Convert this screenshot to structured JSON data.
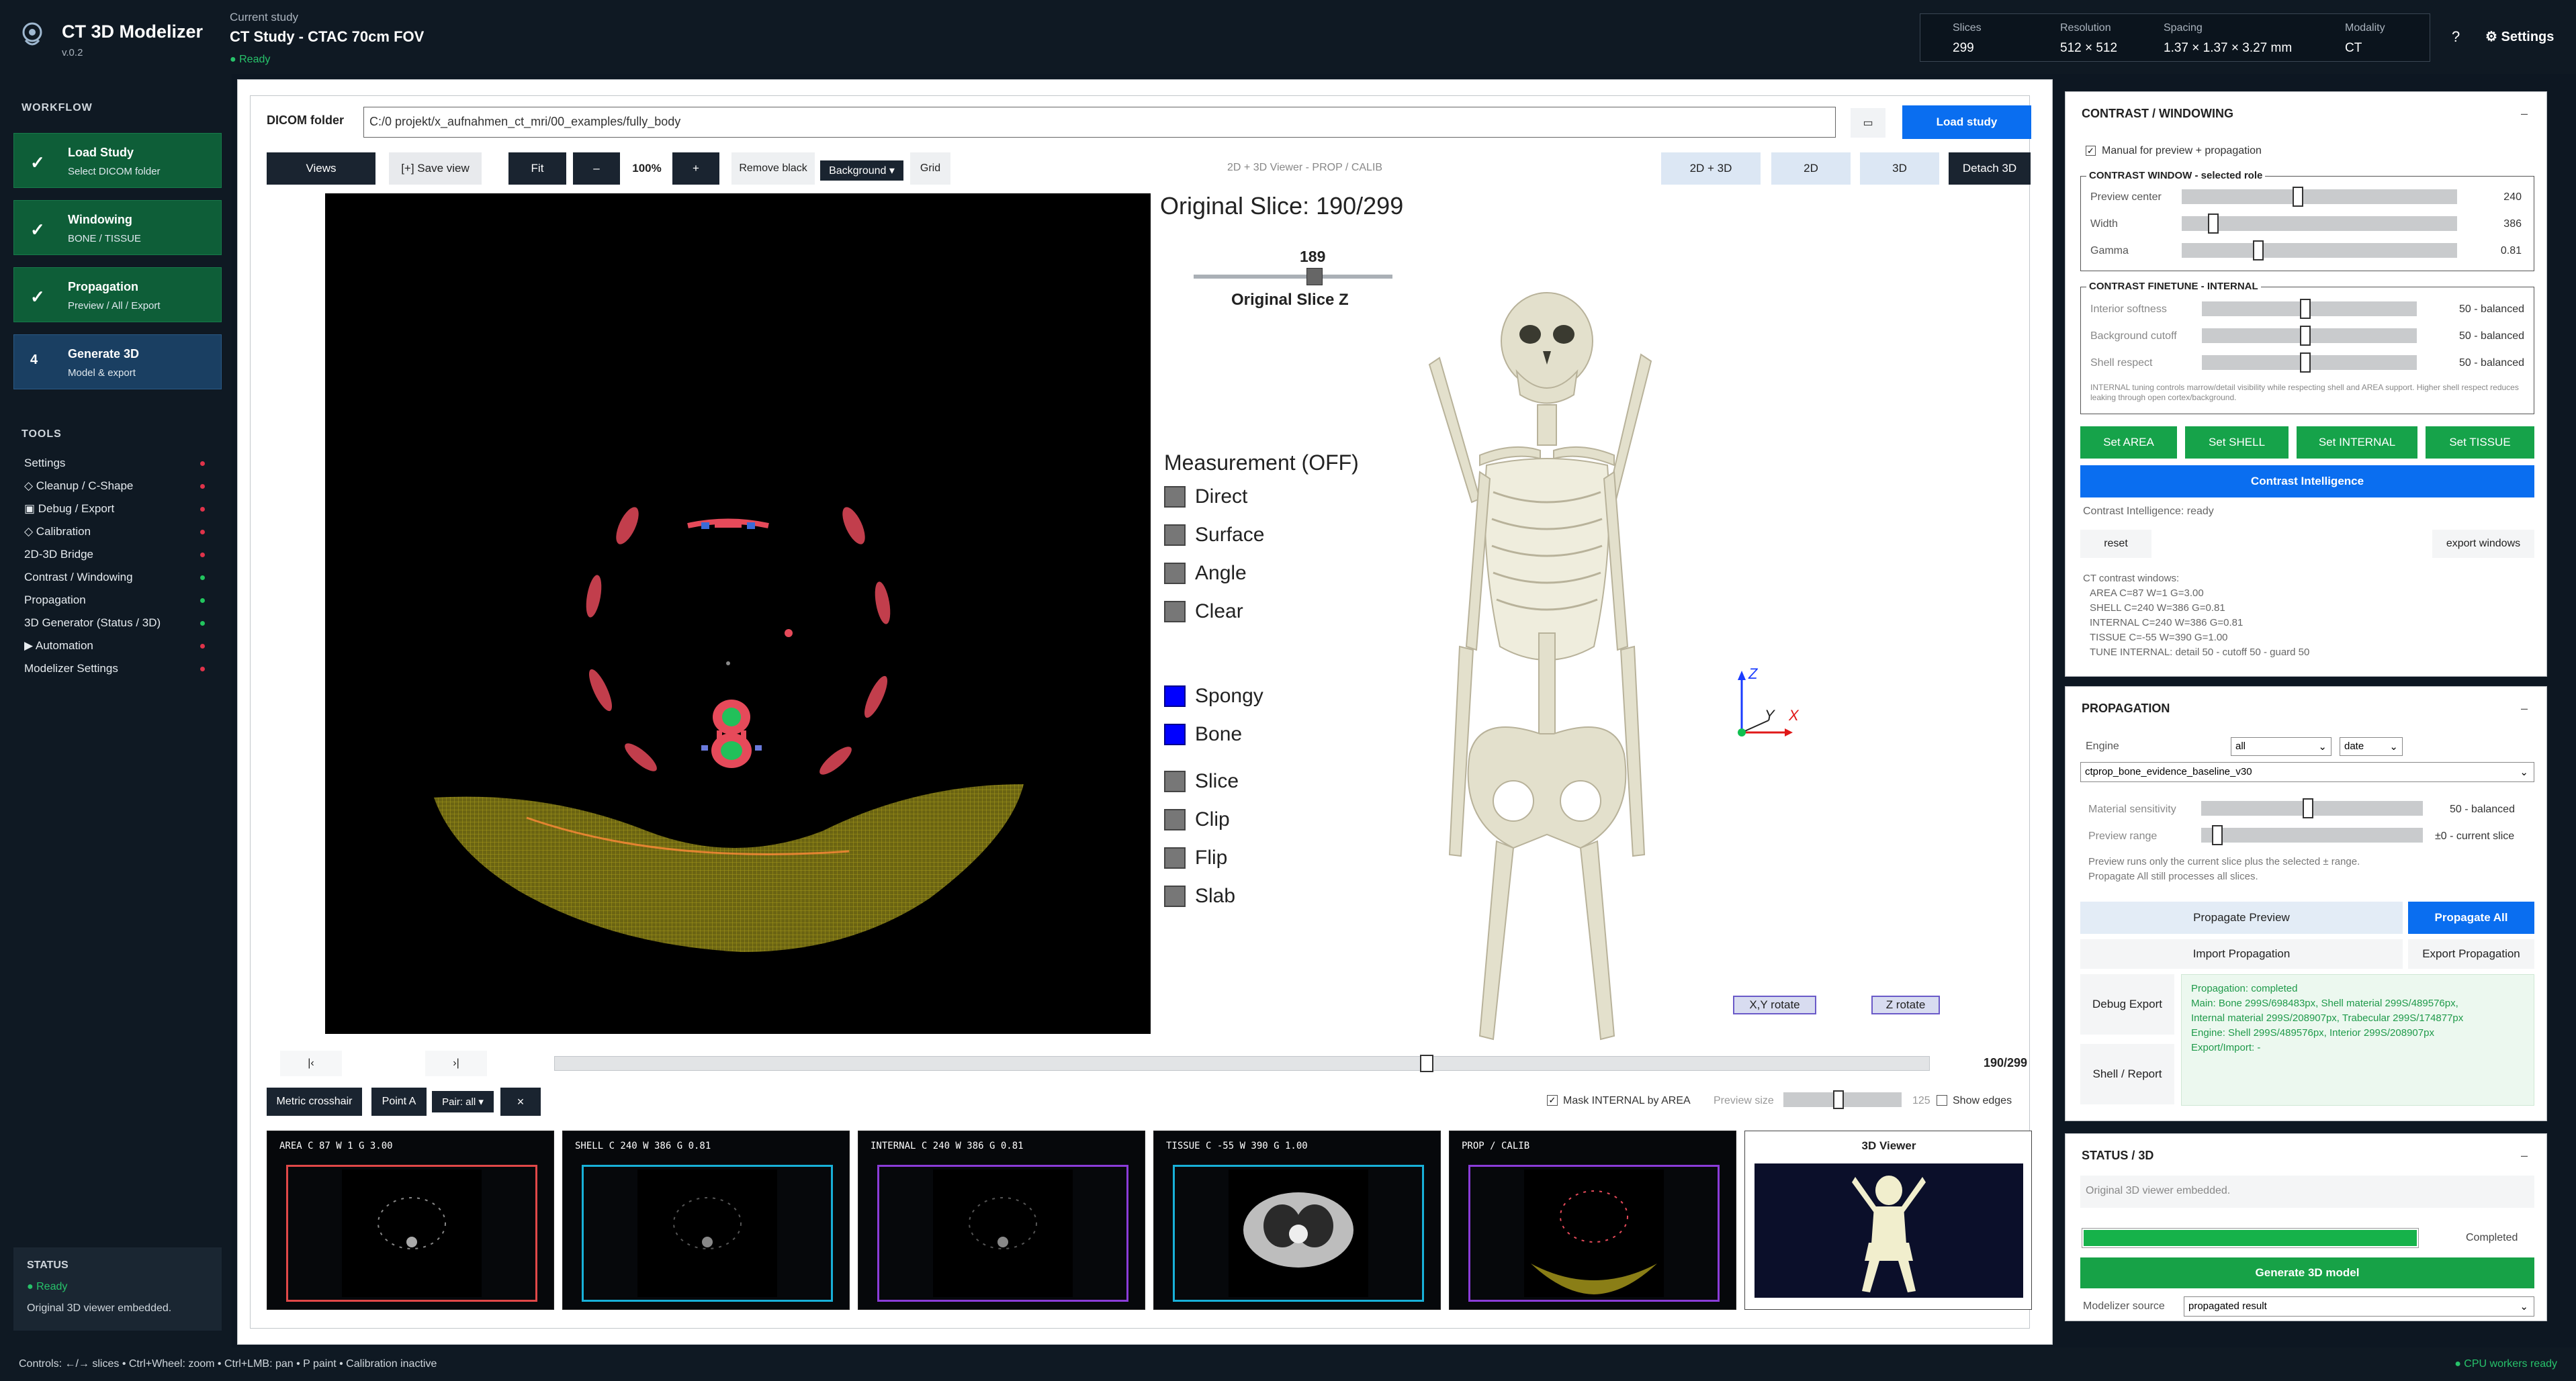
{
  "header": {
    "app_title": "CT 3D Modelizer",
    "app_version": "v.0.2",
    "current_study_label": "Current study",
    "current_study": "CT Study - CTAC 70cm FOV",
    "status": "● Ready",
    "info": [
      {
        "label": "Slices",
        "value": "299"
      },
      {
        "label": "Resolution",
        "value": "512 × 512"
      },
      {
        "label": "Spacing",
        "value": "1.37 × 1.37 × 3.27 mm"
      },
      {
        "label": "Modality",
        "value": "CT"
      }
    ],
    "help": "?",
    "settings": "⚙ Settings"
  },
  "sidebar": {
    "workflow_title": "WORKFLOW",
    "workflow": [
      {
        "icon": "✓",
        "title": "Load Study",
        "sub": "Select DICOM folder"
      },
      {
        "icon": "✓",
        "title": "Windowing",
        "sub": "BONE / TISSUE"
      },
      {
        "icon": "✓",
        "title": "Propagation",
        "sub": "Preview / All / Export"
      },
      {
        "icon": "4",
        "title": "Generate 3D",
        "sub": "Model & export"
      }
    ],
    "tools_title": "TOOLS",
    "tools": [
      {
        "label": "Settings",
        "color": "#e0334a"
      },
      {
        "label": "◇ Cleanup / C-Shape",
        "color": "#e0334a"
      },
      {
        "label": "▣ Debug / Export",
        "color": "#e0334a"
      },
      {
        "label": "◇ Calibration",
        "color": "#e0334a"
      },
      {
        "label": "2D-3D Bridge",
        "color": "#e0334a"
      },
      {
        "label": "Contrast / Windowing",
        "color": "#22c55e"
      },
      {
        "label": "Propagation",
        "color": "#22c55e"
      },
      {
        "label": "3D Generator (Status / 3D)",
        "color": "#22c55e"
      },
      {
        "label": "▶ Automation",
        "color": "#e0334a"
      },
      {
        "label": "Modelizer Settings",
        "color": "#e0334a"
      }
    ],
    "status_title": "STATUS",
    "status_ready": "● Ready",
    "status_msg": "Original 3D viewer embedded."
  },
  "dicom": {
    "label": "DICOM folder",
    "path": "C:/0 projekt/x_aufnahmen_ct_mri/00_examples/fully_body",
    "folder_icon": "▭",
    "load_label": "Load study"
  },
  "toolbar": {
    "views": "Views",
    "save_view": "[+] Save view",
    "fit": "Fit",
    "minus": "–",
    "zoom": "100%",
    "plus": "+",
    "remove_black": "Remove black",
    "background": "Background ▾",
    "grid": "Grid",
    "viewer_title": "2D + 3D Viewer - PROP / CALIB",
    "view_2d3d": "2D + 3D",
    "view_2d": "2D",
    "view_3d": "3D",
    "detach": "Detach 3D"
  },
  "viewer": {
    "original_slice": "Original Slice: 190/299",
    "slider_value": "189",
    "slider_label": "Original Slice Z",
    "measurement_title": "Measurement (OFF)",
    "measure_items": [
      "Direct",
      "Surface",
      "Angle",
      "Clear"
    ],
    "tissue_items": [
      "Spongy",
      "Bone"
    ],
    "view_items": [
      "Slice",
      "Clip",
      "Flip",
      "Slab"
    ],
    "axis_z": "Z",
    "axis_y": "Y",
    "axis_x": "X",
    "xy_rotate": "X,Y rotate",
    "z_rotate": "Z rotate",
    "slice_count": "190/299",
    "slice_fraction": 0.635,
    "prev": "|‹",
    "next": "›|"
  },
  "bottom_toolbar": {
    "metric_crosshair": "Metric crosshair",
    "point_a": "Point A",
    "pair": "Pair: all ▾",
    "close": "×",
    "mask_internal": "Mask INTERNAL by AREA",
    "preview_size": "Preview size",
    "preview_size_val": "125",
    "show_edges": "Show edges"
  },
  "thumbnails": [
    {
      "label": "AREA    C   87  W    1  G 3.00",
      "color": "#e04848"
    },
    {
      "label": "SHELL   C  240  W  386  G 0.81",
      "color": "#18b0d8"
    },
    {
      "label": "INTERNAL C  240  W  386  G 0.81",
      "color": "#8a3cd8"
    },
    {
      "label": "TISSUE   C  -55  W  390  G 1.00",
      "color": "#18b0d8"
    },
    {
      "label": "PROP / CALIB",
      "color": "#8a3cd8"
    }
  ],
  "viewer3d_title": "3D Viewer",
  "contrast": {
    "title": "CONTRAST / WINDOWING",
    "manual": "Manual for preview + propagation",
    "window_title": "CONTRAST WINDOW - selected role",
    "rows": [
      {
        "label": "Preview center",
        "value": "240",
        "pos": 0.42
      },
      {
        "label": "Width",
        "value": "386",
        "pos": 0.1
      },
      {
        "label": "Gamma",
        "value": "0.81",
        "pos": 0.27
      }
    ],
    "finetune_title": "CONTRAST FINETUNE - INTERNAL",
    "finetune_rows": [
      {
        "label": "Interior softness",
        "value": "50 - balanced",
        "pos": 0.48
      },
      {
        "label": "Background cutoff",
        "value": "50 - balanced",
        "pos": 0.48
      },
      {
        "label": "Shell respect",
        "value": "50 - balanced",
        "pos": 0.48
      }
    ],
    "note": "INTERNAL tuning controls marrow/detail visibility while respecting shell and AREA support. Higher shell respect reduces leaking through open cortex/background.",
    "set_buttons": [
      "Set AREA",
      "Set SHELL",
      "Set INTERNAL",
      "Set TISSUE"
    ],
    "intelligence": "Contrast Intelligence",
    "intelligence_status": "Contrast Intelligence: ready",
    "reset": "reset",
    "export_windows": "export windows",
    "summary": [
      "CT contrast windows:",
      "AREA C=87 W=1 G=3.00",
      "SHELL C=240 W=386 G=0.81",
      "INTERNAL C=240 W=386 G=0.81",
      "TISSUE C=-55 W=390 G=1.00",
      "TUNE INTERNAL: detail 50 - cutoff 50 - guard 50"
    ]
  },
  "propagation": {
    "title": "PROPAGATION",
    "engine_label": "Engine",
    "engine": "all",
    "sort": "date",
    "preset": "ctprop_bone_evidence_baseline_v30",
    "sensitivity_label": "Material sensitivity",
    "sensitivity_value": "50 - balanced",
    "sensitivity_pos": 0.48,
    "range_label": "Preview range",
    "range_value": "±0 - current slice",
    "range_pos": 0.05,
    "note1": "Preview runs only the current slice plus the selected ± range.",
    "note2": "Propagate All still processes all slices.",
    "propagate_preview": "Propagate Preview",
    "propagate_all": "Propagate All",
    "import": "Import Propagation",
    "export": "Export Propagation",
    "debug_export": "Debug Export",
    "shell_report": "Shell / Report",
    "log": [
      "Propagation: completed",
      "Main: Bone 299S/698483px, Shell material 299S/489576px,",
      "Internal material 299S/208907px, Trabecular 299S/174877px",
      "Engine: Shell 299S/489576px, Interior 299S/208907px",
      "Export/Import: -"
    ]
  },
  "status3d": {
    "title": "STATUS / 3D",
    "msg": "Original 3D viewer embedded.",
    "progress": 1.0,
    "completed": "Completed",
    "generate": "Generate 3D model",
    "source_label": "Modelizer source",
    "source": "propagated result"
  },
  "footer": {
    "controls": "Controls: ←/→ slices • Ctrl+Wheel: zoom • Ctrl+LMB: pan • P paint • Calibration inactive",
    "workers": "● CPU workers ready"
  }
}
